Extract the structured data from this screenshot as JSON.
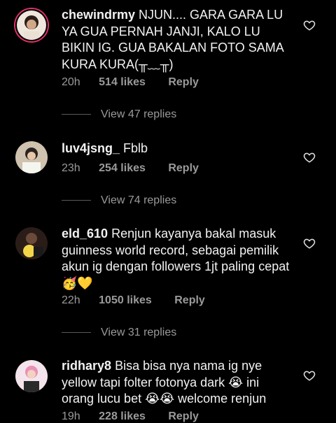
{
  "comments": [
    {
      "username": "chewindrmy",
      "text": "NJUN.... GARA GARA LU YA GUA PERNAH JANJI, KALO LU BIKIN IG. GUA BAKALAN FOTO SAMA KURA KURA(╥﹏╥)",
      "time": "20h",
      "likes": "514 likes",
      "reply_label": "Reply",
      "view_replies": "View 47 replies",
      "avatar_color": "#e4c9a8"
    },
    {
      "username": "luv4jsng_",
      "text": "Fblb",
      "time": "23h",
      "likes": "254 likes",
      "reply_label": "Reply",
      "view_replies": "View 74 replies",
      "avatar_color": "#d9cbb5"
    },
    {
      "username": "eld_610",
      "text": "Renjun kayanya bakal masuk guinness world record, sebagai pemilik akun ig dengan followers 1jt paling cepat 🥳💛",
      "time": "22h",
      "likes": "1050 likes",
      "reply_label": "Reply",
      "view_replies": "View 31 replies",
      "avatar_color": "#3a2a22"
    },
    {
      "username": "ridhary8",
      "text": "Bisa bisa nya nama ig nye yellow tapi folter fotonya dark 😭 ini orang lucu bet 😭😭 welcome renjun",
      "time": "19h",
      "likes": "228 likes",
      "reply_label": "Reply",
      "avatar_color": "#f0d8e4"
    }
  ],
  "icons": {
    "heart": "heart-outline-icon"
  },
  "colors": {
    "background": "#000000",
    "text": "#f2f2f2",
    "secondary": "#9a9a9a",
    "story_ring": "#e1306c"
  }
}
